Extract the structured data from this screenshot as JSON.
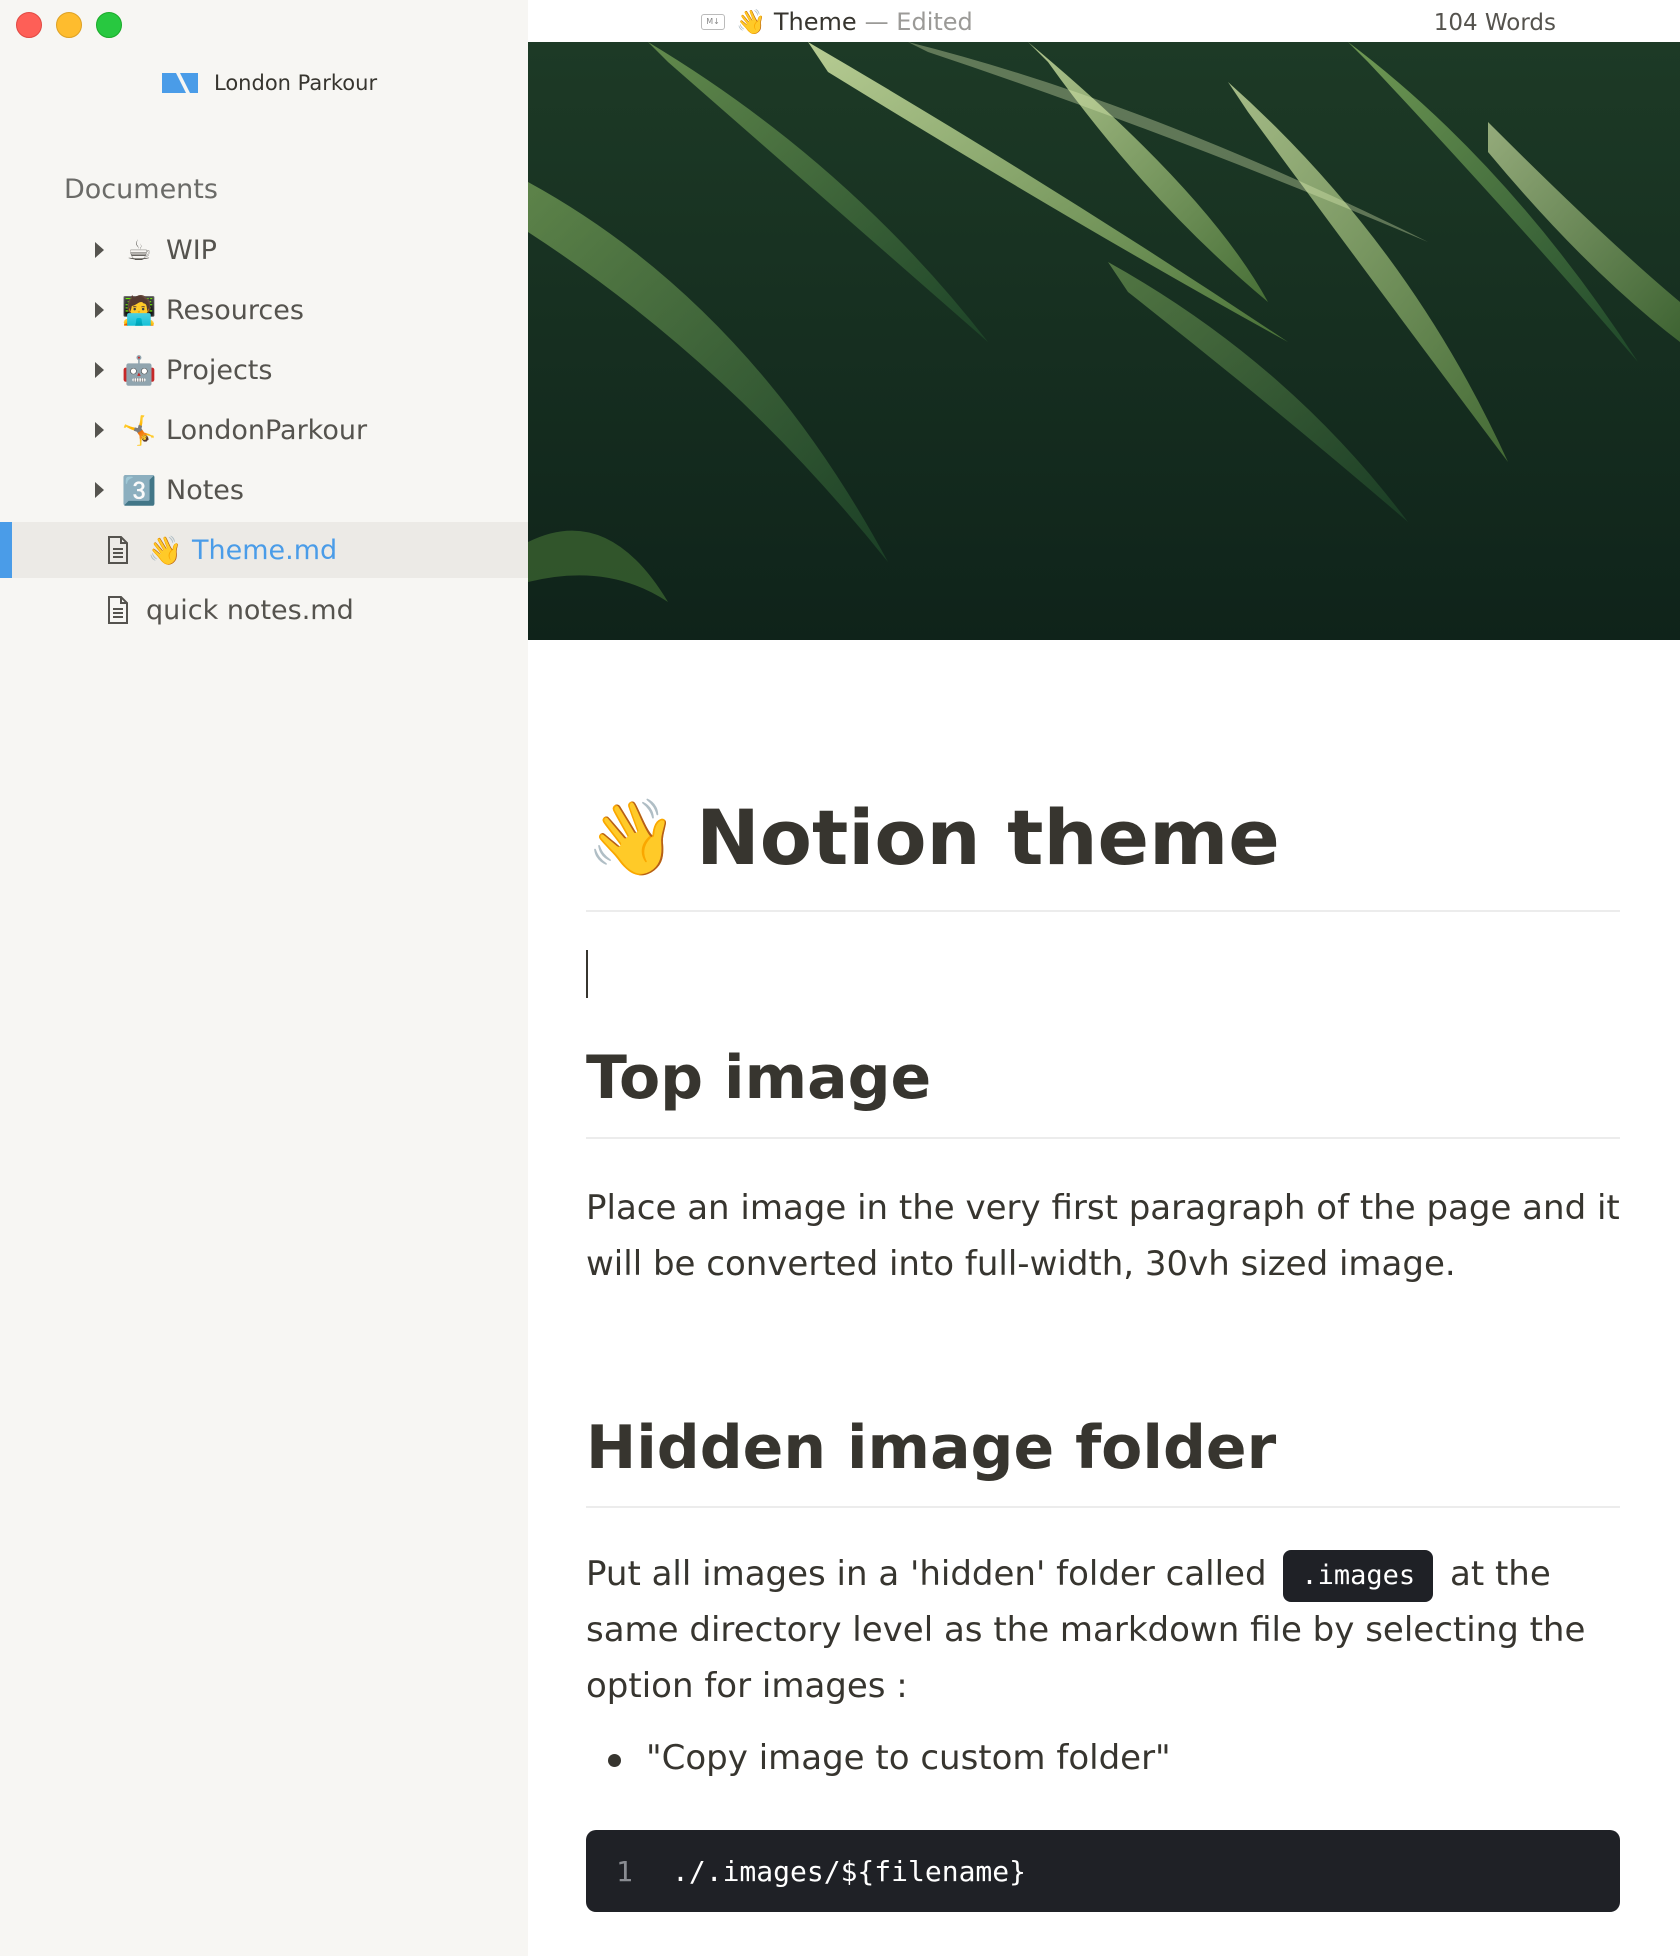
{
  "window": {
    "traffic_lights": [
      "close",
      "minimize",
      "maximize"
    ]
  },
  "sidebar": {
    "workspace_name": "London Parkour",
    "section_label": "Documents",
    "folders": [
      {
        "emoji": "☕",
        "label": "WIP"
      },
      {
        "emoji": "🧑‍💻",
        "label": "Resources"
      },
      {
        "emoji": "🤖",
        "label": "Projects"
      },
      {
        "emoji": "🤸",
        "label": "LondonParkour"
      },
      {
        "emoji": "3️⃣",
        "label": "Notes"
      }
    ],
    "files": [
      {
        "emoji": "👋",
        "label": "Theme.md",
        "selected": true
      },
      {
        "emoji": "",
        "label": "quick notes.md",
        "selected": false
      }
    ],
    "accent_color": "#4a9ce8"
  },
  "titlebar": {
    "badge": "M↓",
    "emoji": "👋",
    "doc_title": "Theme",
    "status": "— Edited",
    "word_count": "104 Words"
  },
  "document": {
    "h1_emoji": "👋",
    "h1": "Notion theme",
    "section1_title": "Top image",
    "section1_body": "Place an image in the very first paragraph of the page and it will be converted  into full-width, 30vh sized image.",
    "section2_title": "Hidden image folder",
    "section2_body_before": "Put all images in a 'hidden' folder called",
    "section2_code": ".images",
    "section2_body_after": "at the same directory level as the markdown file by selecting the option for images :",
    "bullet": "\"Copy image to custom folder\"",
    "code_line_number": "1",
    "code_line": "./.images/${filename}"
  }
}
